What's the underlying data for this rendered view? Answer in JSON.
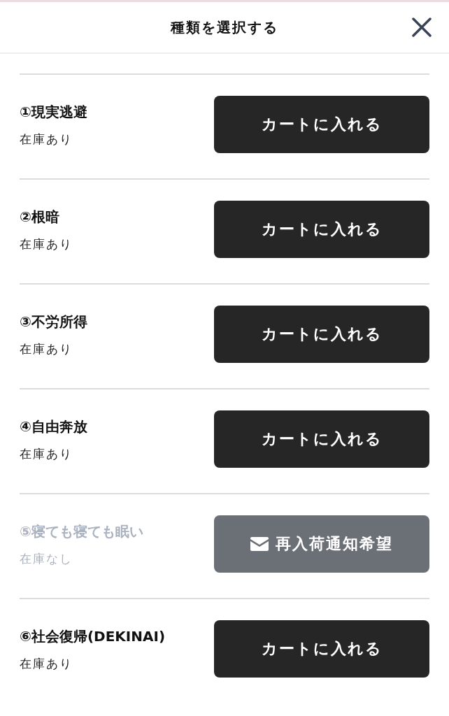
{
  "header": {
    "title": "種類を選択する"
  },
  "items": [
    {
      "name": "①現実逃避",
      "stock": "在庫あり",
      "in_stock": true,
      "button": "カートに入れる"
    },
    {
      "name": "②根暗",
      "stock": "在庫あり",
      "in_stock": true,
      "button": "カートに入れる"
    },
    {
      "name": "③不労所得",
      "stock": "在庫あり",
      "in_stock": true,
      "button": "カートに入れる"
    },
    {
      "name": "④自由奔放",
      "stock": "在庫あり",
      "in_stock": true,
      "button": "カートに入れる"
    },
    {
      "name": "⑤寝ても寝ても眠い",
      "stock": "在庫なし",
      "in_stock": false,
      "button": "再入荷通知希望"
    },
    {
      "name": "⑥社会復帰(DEKINAI)",
      "stock": "在庫あり",
      "in_stock": true,
      "button": "カートに入れる"
    }
  ]
}
